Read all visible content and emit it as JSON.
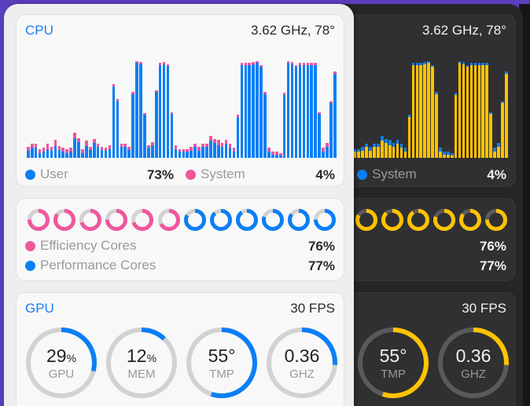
{
  "cpu": {
    "title": "CPU",
    "freq_temp": "3.62 GHz, 78°",
    "user_label": "User",
    "user_value": "73%",
    "system_label": "System",
    "system_value": "4%",
    "chart_data": {
      "type": "bar",
      "stacked": true,
      "ylim": [
        0,
        100
      ],
      "series": [
        {
          "name": "User",
          "values": [
            7,
            10,
            10,
            5,
            6,
            9,
            7,
            12,
            8,
            6,
            5,
            6,
            20,
            16,
            5,
            12,
            8,
            15,
            11,
            8,
            7,
            9,
            72,
            57,
            11,
            11,
            8,
            64,
            95,
            94,
            43,
            10,
            13,
            66,
            93,
            94,
            92,
            44,
            9,
            6,
            6,
            6,
            7,
            11,
            7,
            11,
            11,
            17,
            15,
            13,
            11,
            14,
            10,
            6,
            41,
            93,
            93,
            93,
            94,
            95,
            91,
            64,
            6,
            3,
            3,
            2,
            63,
            95,
            94,
            91,
            93,
            93,
            93,
            93,
            93,
            44,
            6,
            11,
            55,
            84
          ]
        },
        {
          "name": "System",
          "values": [
            4,
            4,
            4,
            4,
            4,
            5,
            4,
            6,
            4,
            4,
            4,
            4,
            5,
            4,
            4,
            5,
            3,
            4,
            3,
            3,
            3,
            4,
            2,
            2,
            3,
            3,
            3,
            2,
            2,
            2,
            2,
            3,
            3,
            2,
            2,
            2,
            2,
            2,
            4,
            3,
            3,
            3,
            4,
            3,
            4,
            3,
            3,
            5,
            4,
            5,
            4,
            4,
            4,
            4,
            2,
            2,
            2,
            2,
            2,
            2,
            2,
            2,
            4,
            3,
            3,
            3,
            2,
            2,
            2,
            2,
            2,
            2,
            2,
            2,
            2,
            2,
            4,
            4,
            2,
            3
          ]
        }
      ]
    }
  },
  "cores": {
    "efficiency_label": "Efficiency Cores",
    "efficiency_value": "76%",
    "performance_label": "Performance Cores",
    "performance_value": "77%",
    "efficiency_loads": [
      0.75,
      0.85,
      0.7,
      0.75,
      0.7,
      0.67
    ],
    "performance_loads": [
      0.83,
      0.88,
      0.9,
      0.8,
      0.85,
      0.75
    ]
  },
  "gpu": {
    "title": "GPU",
    "fps": "30 FPS",
    "gauges": [
      {
        "value": "29",
        "unit": "%",
        "label": "GPU",
        "fill": 0.29
      },
      {
        "value": "12",
        "unit": "%",
        "label": "MEM",
        "fill": 0.12
      },
      {
        "value": "55°",
        "unit": "",
        "label": "TMP",
        "fill": 0.55
      },
      {
        "value": "0.36",
        "unit": "",
        "label": "GHZ",
        "fill": 0.26
      }
    ]
  },
  "themes": {
    "light": {
      "user": "#0a7ff5",
      "system": "#f0569c",
      "efficiency": "#f0569c",
      "performance": "#0a7ff5",
      "track": "#d2d2d2",
      "gauge": "#0a7ff5"
    },
    "dark": {
      "user": "#ffc300",
      "system": "#0a7ff5",
      "efficiency": "#ffc300",
      "performance": "#ffc300",
      "track": "#5a5a5c",
      "gauge": "#ffc300"
    }
  }
}
